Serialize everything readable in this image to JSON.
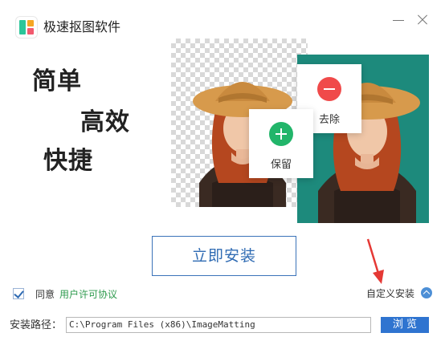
{
  "app": {
    "title": "极速抠图软件"
  },
  "hero": {
    "slogans": [
      "简单",
      "高效",
      "快捷"
    ],
    "remove_label": "去除",
    "keep_label": "保留"
  },
  "actions": {
    "install_label": "立即安装"
  },
  "agreement": {
    "agree_text": "同意",
    "license_link": "用户许可协议",
    "checked": true
  },
  "custom_install_label": "自定义安装",
  "path": {
    "label": "安装路径：",
    "value": "C:\\Program Files (x86)\\ImageMatting",
    "browse_label": "浏 览"
  },
  "colors": {
    "accent": "#2f74d0",
    "remove": "#f04a4a",
    "keep": "#22b56a",
    "teal_bg": "#1d8a7c",
    "arrow": "#e53935"
  }
}
